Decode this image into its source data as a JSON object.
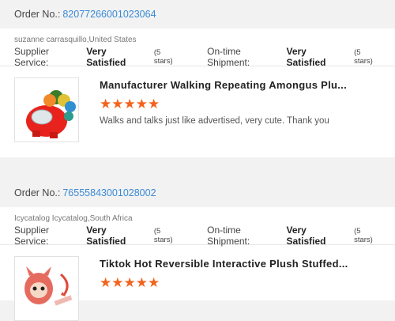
{
  "orders": [
    {
      "order_label": "Order No.:",
      "order_number": "82077266001023064",
      "buyer": "suzanne carrasquillo,United States",
      "supplier_label": "Supplier Service:",
      "supplier_value": "Very Satisfied",
      "supplier_stars": "(5 stars)",
      "shipment_label": "On-time Shipment:",
      "shipment_value": "Very Satisfied",
      "shipment_stars": "(5 stars)",
      "product_title": "Manufacturer Walking Repeating Amongus Plu...",
      "rating_stars": "★★★★★",
      "rating": 5,
      "review": "Walks and talks just like advertised, very cute. Thank you",
      "thumb_icon": "walking-robot-toy-icon"
    },
    {
      "order_label": "Order No.:",
      "order_number": "76555843001028002",
      "buyer": "Icycatalog Icycatalog,South Africa",
      "supplier_label": "Supplier Service:",
      "supplier_value": "Very Satisfied",
      "supplier_stars": "(5 stars)",
      "shipment_label": "On-time Shipment:",
      "shipment_value": "Very Satisfied",
      "shipment_stars": "(5 stars)",
      "product_title": "Tiktok Hot Reversible Interactive Plush Stuffed...",
      "rating_stars": "★★★★★",
      "rating": 5,
      "review": "",
      "thumb_icon": "plush-toy-icon"
    }
  ],
  "colors": {
    "link": "#3a8ad6",
    "star": "#f2631c",
    "background": "#f2f2f2"
  }
}
